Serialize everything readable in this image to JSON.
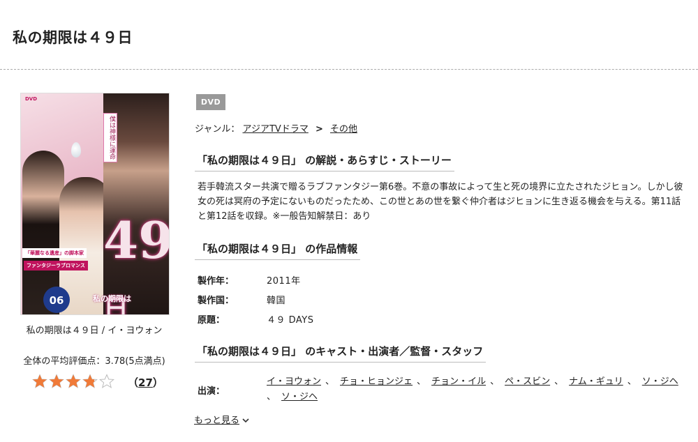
{
  "page": {
    "title": "私の期限は４９日"
  },
  "cover": {
    "dvd_logo": "DVD",
    "tagline": "僕は神様に運命",
    "big_number": "49",
    "big_suffix": "日",
    "vol": "06",
    "cover_title": "私の期限は",
    "band1": "「華麗なる遺産」の脚本家",
    "band2": "ファンタジーラブロマンス"
  },
  "product": {
    "caption": "私の期限は４９日 / イ・ヨウォン",
    "avg_rating_text": "全体の平均評価点：3.78(5点満点)",
    "rating": 3.78,
    "rating_max": 5,
    "review_count_open": "（",
    "review_count": "27",
    "review_count_close": "）"
  },
  "badge": "DVD",
  "genre": {
    "label": "ジャンル：",
    "items": [
      "アジアTVドラマ",
      "その他"
    ],
    "separator": ">"
  },
  "sections": {
    "synopsis_heading": "「私の期限は４９日」 の解説・あらすじ・ストーリー",
    "synopsis": "若手韓流スター共演で贈るラブファンタジー第6巻。不意の事故によって生と死の境界に立たされたジヒョン。しかし彼女の死は冥府の予定にないものだったため、この世とあの世を繋ぐ仲介者はジヒョンに生き返る機会を与える。第11話と第12話を収録。※一般告知解禁日：あり",
    "info_heading": "「私の期限は４９日」 の作品情報",
    "cast_heading": "「私の期限は４９日」 のキャスト・出演者／監督・スタッフ"
  },
  "info": [
    {
      "label": "製作年：",
      "value": "2011年"
    },
    {
      "label": "製作国：",
      "value": "韓国"
    },
    {
      "label": "原題：",
      "value": "４９ DAYS"
    }
  ],
  "cast": {
    "label": "出演：",
    "names": [
      "イ・ヨウォン",
      "チョ・ヒョンジェ",
      "チョン・イル",
      "ペ・スビン",
      "ナム・ギュリ",
      "ソ・ジヘ",
      "ソ・ジヘ"
    ],
    "comma": "、"
  },
  "more_label": "もっと見る",
  "colors": {
    "star": "#f07a38",
    "badge": "#999999",
    "accent": "#c0135d"
  }
}
